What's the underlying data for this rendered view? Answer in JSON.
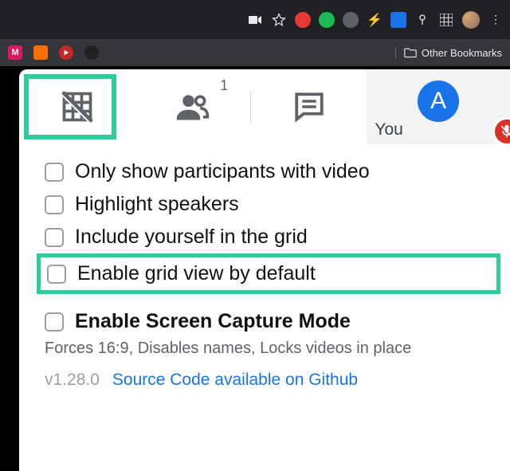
{
  "browser": {
    "bookmarks_folder": "Other Bookmarks"
  },
  "tabs": {
    "people_count": "1"
  },
  "tile": {
    "you_label": "You",
    "avatar_letter": "A"
  },
  "options": {
    "only_video": "Only show participants with video",
    "highlight_speakers": "Highlight speakers",
    "include_self": "Include yourself in the grid",
    "enable_default": "Enable grid view by default",
    "screen_capture": "Enable Screen Capture Mode",
    "screen_capture_desc": "Forces 16:9, Disables names, Locks videos in place"
  },
  "footer": {
    "version": "v1.28.0",
    "source_link": "Source Code available on Github"
  }
}
